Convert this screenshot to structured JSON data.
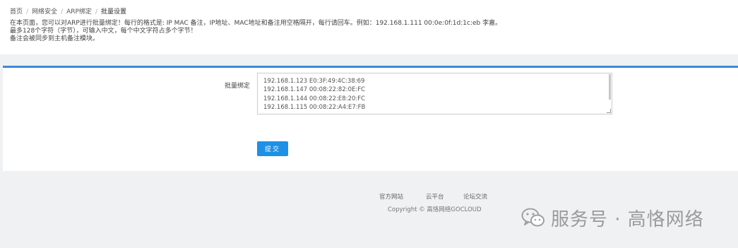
{
  "breadcrumb": {
    "items": [
      "首页",
      "网络安全",
      "ARP绑定"
    ],
    "current": "批量设置",
    "separator": "/"
  },
  "description": {
    "line1": "在本页面，您可以对ARP进行批量绑定！每行的格式是: IP MAC 备注，IP地址、MAC地址和备注用空格隔开，每行请回车。例如：192.168.1.111 00:0e:0f:1d:1c:eb 李嘉。",
    "line2": "最多128个字符（字节），可输入中文，每个中文字符占多个字节！",
    "line3": "备注会被同步到主机备注模块。"
  },
  "form": {
    "label": "批量绑定",
    "entries": [
      "192.168.1.123 E0:3F:49:4C:38:69",
      "192.168.1.147 00:08:22:82:0E:FC",
      "192.168.1.144 00:08:22:E8:20:FC",
      "192.168.1.115 00:08:22:A4:E7:FB"
    ],
    "submit_label": "提交"
  },
  "footer": {
    "links": [
      "官方网站",
      "云平台",
      "论坛交流"
    ],
    "copyright": "Copyright © 高恪网络GOCLOUD"
  },
  "watermark": {
    "icon": "wechat-icon",
    "text": "服务号 · 高恪网络"
  },
  "colors": {
    "accent": "#1e90e6",
    "panel_border": "#3a8ad8",
    "page_bg": "#f0f1f3"
  }
}
